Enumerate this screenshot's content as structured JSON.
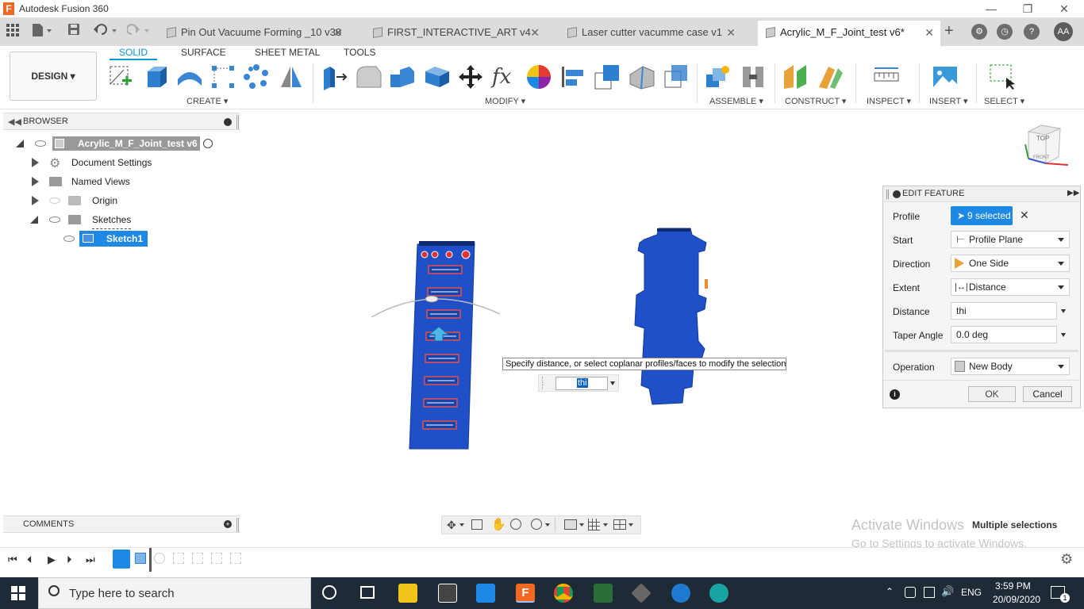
{
  "window": {
    "app_title": "Autodesk Fusion 360",
    "logo_letter": "F",
    "minimize": "—",
    "restore": "❐",
    "close": "✕"
  },
  "tabs": [
    {
      "label": "Pin Out Vacuume Forming _10 v30",
      "close": "✕"
    },
    {
      "label": "FIRST_INTERACTIVE_ART v4",
      "close": "✕"
    },
    {
      "label": "Laser cutter vacumme case v1",
      "close": "✕"
    },
    {
      "label": "Acrylic_M_F_Joint_test v6*",
      "close": "✕"
    }
  ],
  "user_initials": "AA",
  "toolbar": {
    "workspace": "DESIGN ▾",
    "ws_tabs": [
      "SOLID",
      "SURFACE",
      "SHEET METAL",
      "TOOLS"
    ],
    "groups": {
      "create": "CREATE ▾",
      "modify": "MODIFY ▾",
      "assemble": "ASSEMBLE ▾",
      "construct": "CONSTRUCT ▾",
      "inspect": "INSPECT ▾",
      "insert": "INSERT ▾",
      "select": "SELECT ▾"
    }
  },
  "browser": {
    "title": "BROWSER",
    "root": "Acrylic_M_F_Joint_test v6",
    "items": [
      "Document Settings",
      "Named Views",
      "Origin",
      "Sketches"
    ],
    "sketch": "Sketch1"
  },
  "comments": "COMMENTS",
  "viewcube": {
    "top": "TOP",
    "front": "FRONT"
  },
  "tooltip": "Specify distance, or select coplanar profiles/faces to modify the selection",
  "inline_input": "thi",
  "edit_feature": {
    "title": "EDIT FEATURE",
    "profile_label": "Profile",
    "profile_value": "9 selected",
    "start_label": "Start",
    "start_value": "Profile Plane",
    "direction_label": "Direction",
    "direction_value": "One Side",
    "extent_label": "Extent",
    "extent_value": "Distance",
    "distance_label": "Distance",
    "distance_value": "thi",
    "taper_label": "Taper Angle",
    "taper_value": "0.0 deg",
    "operation_label": "Operation",
    "operation_value": "New Body",
    "ok": "OK",
    "cancel": "Cancel"
  },
  "watermark": {
    "line1": "Activate Windows",
    "line2": "Go to Settings to activate Windows."
  },
  "status": "Multiple selections",
  "taskbar": {
    "search_placeholder": "Type here to search",
    "lang": "ENG",
    "time": "3:59 PM",
    "date": "20/09/2020",
    "notif_count": "1"
  },
  "colors": {
    "accent": "#0696d7",
    "model_blue": "#1f50c8",
    "taskbar": "#1e2a36"
  }
}
